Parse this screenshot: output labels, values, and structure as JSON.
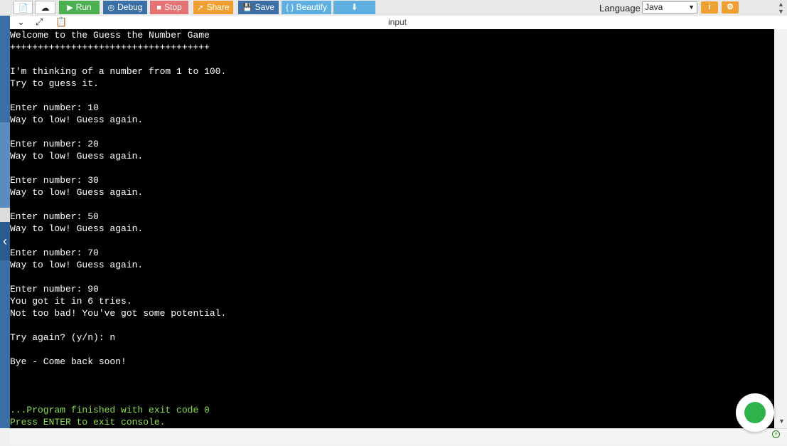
{
  "toolbar": {
    "run_label": "Run",
    "debug_label": "Debug",
    "stop_label": "Stop",
    "share_label": "Share",
    "save_label": "Save",
    "beautify_label": "{ } Beautify",
    "language_label": "Language",
    "language_value": "Java",
    "info_icon": "i",
    "settings_icon": "⚙"
  },
  "subbar": {
    "input_label": "input"
  },
  "console": {
    "lines": [
      "Welcome to the Guess the Number Game",
      "++++++++++++++++++++++++++++++++++++",
      "",
      "I'm thinking of a number from 1 to 100.",
      "Try to guess it.",
      "",
      "Enter number: 10",
      "Way to low! Guess again.",
      "",
      "Enter number: 20",
      "Way to low! Guess again.",
      "",
      "Enter number: 30",
      "Way to low! Guess again.",
      "",
      "Enter number: 50",
      "Way to low! Guess again.",
      "",
      "Enter number: 70",
      "Way to low! Guess again.",
      "",
      "Enter number: 90",
      "You got it in 6 tries.",
      "Not too bad! You've got some potential.",
      "",
      "Try again? (y/n): n",
      "",
      "Bye - Come back soon!"
    ],
    "finish_line": "...Program finished with exit code 0",
    "exit_line": "Press ENTER to exit console."
  },
  "colors": {
    "run": "#4caf50",
    "debug": "#3a6ea5",
    "stop": "#e57373",
    "share": "#f0a030",
    "save": "#3a6ea5",
    "beautify": "#5fb0e0",
    "download": "#5fb0e0",
    "console_bg": "#000000",
    "console_finish": "#8ee04a"
  }
}
